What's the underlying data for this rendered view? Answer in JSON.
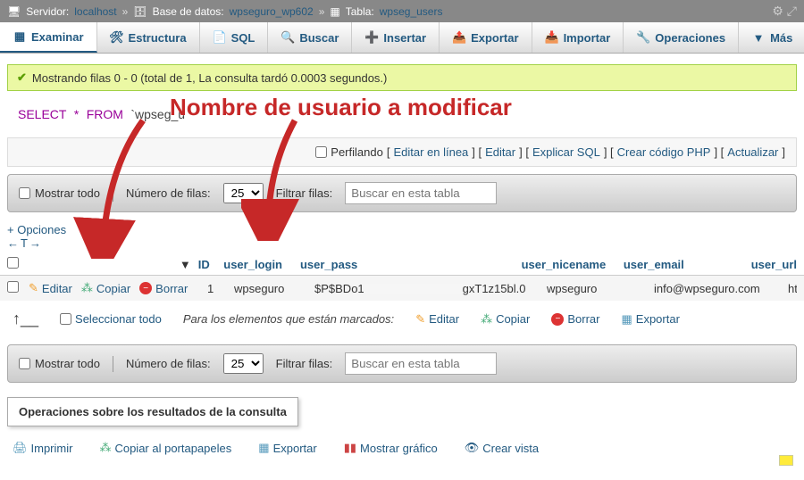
{
  "breadcrumb": {
    "server_lbl": "Servidor:",
    "server": "localhost",
    "db_lbl": "Base de datos:",
    "db": "wpseguro_wp602",
    "table_lbl": "Tabla:",
    "table": "wpseg_users"
  },
  "tabs": {
    "browse": "Examinar",
    "structure": "Estructura",
    "sql": "SQL",
    "search": "Buscar",
    "insert": "Insertar",
    "export": "Exportar",
    "import": "Importar",
    "ops": "Operaciones",
    "more": "Más"
  },
  "notice": "Mostrando filas 0 - 0 (total de 1, La consulta tardó 0.0003 segundos.)",
  "sql": {
    "select": "SELECT",
    "star": "*",
    "from": "FROM",
    "table": "`wpseg_u"
  },
  "annotation": "Nombre de usuario a modificar",
  "linkrow": {
    "profiling": "Perfilando",
    "inline": "Editar en línea",
    "edit": "Editar",
    "explain": "Explicar SQL",
    "php": "Crear código PHP",
    "refresh": "Actualizar"
  },
  "toolbar": {
    "showall": "Mostrar todo",
    "rows_lbl": "Número de filas:",
    "rows_val": "25",
    "filter_lbl": "Filtrar filas:",
    "filter_ph": "Buscar en esta tabla"
  },
  "opts": {
    "label": "+ Opciones",
    "arrows": "←T→"
  },
  "thead": {
    "sort": "▼",
    "id": "ID",
    "login": "user_login",
    "pass": "user_pass",
    "nice": "user_nicename",
    "email": "user_email",
    "url": "user_url"
  },
  "row": {
    "edit": "Editar",
    "copy": "Copiar",
    "delete": "Borrar",
    "id": "1",
    "login": "wpseguro",
    "pass_pre": "$P$BDo1",
    "pass_post": "gxT1z15bl.0",
    "nice": "wpseguro",
    "email": "info@wpseguro.com",
    "url": "http://wpsegui"
  },
  "bulk": {
    "selall": "Seleccionar todo",
    "withsel": "Para los elementos que están marcados:",
    "edit": "Editar",
    "copy": "Copiar",
    "delete": "Borrar",
    "export": "Exportar"
  },
  "opsbox": "Operaciones sobre los resultados de la consulta",
  "qops": {
    "print": "Imprimir",
    "clip": "Copiar al portapapeles",
    "export": "Exportar",
    "chart": "Mostrar gráfico",
    "view": "Crear vista"
  }
}
